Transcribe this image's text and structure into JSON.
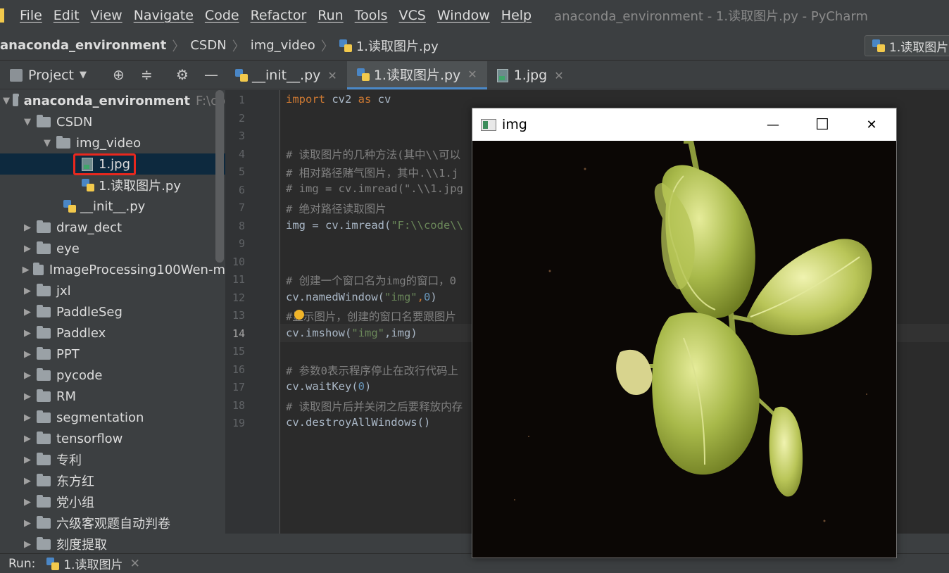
{
  "menu": {
    "items": [
      "File",
      "Edit",
      "View",
      "Navigate",
      "Code",
      "Refactor",
      "Run",
      "Tools",
      "VCS",
      "Window",
      "Help"
    ],
    "window_title": "anaconda_environment - 1.读取图片.py - PyCharm"
  },
  "breadcrumb": {
    "items": [
      "anaconda_environment",
      "CSDN",
      "img_video",
      "1.读取图片.py"
    ],
    "run_config": "1.读取图片"
  },
  "project": {
    "label": "Project",
    "root": "anaconda_environment",
    "root_path": "F:\\co",
    "tree": [
      "CSDN",
      "img_video",
      "1.jpg",
      "1.读取图片.py",
      "__init__.py",
      "draw_dect",
      "eye",
      "ImageProcessing100Wen-m",
      "jxl",
      "PaddleSeg",
      "Paddlex",
      "PPT",
      "pycode",
      "RM",
      "segmentation",
      "tensorflow",
      "专利",
      "东方红",
      "党小组",
      "六级客观题自动判卷",
      "刻度提取"
    ]
  },
  "tabs": [
    {
      "label": "__init__.py"
    },
    {
      "label": "1.读取图片.py"
    },
    {
      "label": "1.jpg"
    }
  ],
  "editor": {
    "line_numbers": [
      "1",
      "2",
      "3",
      "4",
      "5",
      "6",
      "7",
      "8",
      "9",
      "10",
      "11",
      "12",
      "13",
      "14",
      "15",
      "16",
      "17",
      "18",
      "19"
    ],
    "lines": {
      "l1_kw1": "import",
      "l1_mod": " cv2 ",
      "l1_kw2": "as",
      "l1_alias": " cv",
      "l4": "# 读取图片的几种方法(其中\\\\可以",
      "l5": "# 相对路径赌气图片，其中.\\\\1.j",
      "l6": "# img = cv.imread(\".\\\\1.jpg",
      "l7": "# 绝对路径读取图片",
      "l8_a": "img = cv.imread(",
      "l8_s": "\"F:\\\\code\\\\",
      "l11": "# 创建一个窗口名为img的窗口，0",
      "l12_a": "cv.namedWindow(",
      "l12_s": "\"img\"",
      "l12_c": ",",
      "l12_n": "0",
      "l12_e": ")",
      "l13": "#显示图片，创建的窗口名要跟图片",
      "l14_a": "cv.imshow(",
      "l14_s": "\"img\"",
      "l14_e": ",img)",
      "l16": "# 参数0表示程序停止在改行代码上",
      "l17_a": "cv.waitKey(",
      "l17_n": "0",
      "l17_e": ")",
      "l18": "# 读取图片后并关闭之后要释放内存",
      "l19": "cv.destroyAllWindows()"
    }
  },
  "image_window": {
    "title": "img",
    "minimize": "—",
    "maximize": "☐",
    "close": "✕"
  },
  "runbar": {
    "label": "Run:",
    "config": "1.读取图片"
  }
}
